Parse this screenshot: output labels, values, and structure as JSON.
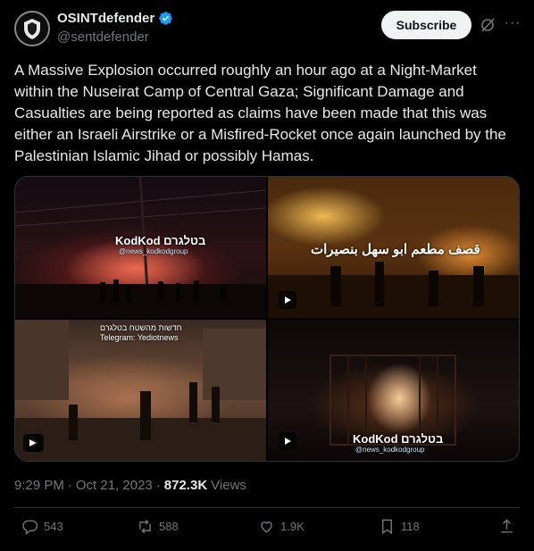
{
  "author": {
    "display_name": "OSINTdefender",
    "handle": "@sentdefender",
    "verified_icon": "verified-badge-icon",
    "avatar_icon": "shield-avatar-icon"
  },
  "header": {
    "subscribe_label": "Subscribe",
    "grok_icon": "grok-icon",
    "more_label": "···"
  },
  "tweet_text": "A Massive Explosion occurred roughly an hour ago at a Night-Market within the Nuseirat Camp of Central Gaza; Significant Damage and Casualties are being reported as claims have been made that this was either an Israeli Airstrike or a Misfired-Rocket once again launched by the Palestinian Islamic Jihad or possibly Hamas.",
  "media": {
    "items": [
      {
        "type": "video",
        "watermark": "KodKod בטלגרם",
        "watermark_sub": "@news_kodkodgroup"
      },
      {
        "type": "video",
        "caption": "قصف مطعم ابو سهل بنصيرات"
      },
      {
        "type": "video",
        "caption_line1": "חדשות מהשטח בטלגרם",
        "caption_line2": "Telegram: Yediotnews"
      },
      {
        "type": "video",
        "watermark": "KodKod בטלגרם",
        "watermark_sub": "@news_kodkodgroup"
      }
    ]
  },
  "meta": {
    "time": "9:29 PM",
    "separator": "·",
    "date": "Oct 21, 2023",
    "separator2": "·",
    "views_count": "872.3K",
    "views_label": "Views"
  },
  "actions": {
    "replies": "543",
    "reposts": "588",
    "likes": "1.9K",
    "bookmarks": "118"
  },
  "colors": {
    "background": "#000000",
    "text": "#e7e9ea",
    "muted": "#71767b",
    "verified": "#1d9bf0",
    "divider": "#2f3336"
  }
}
